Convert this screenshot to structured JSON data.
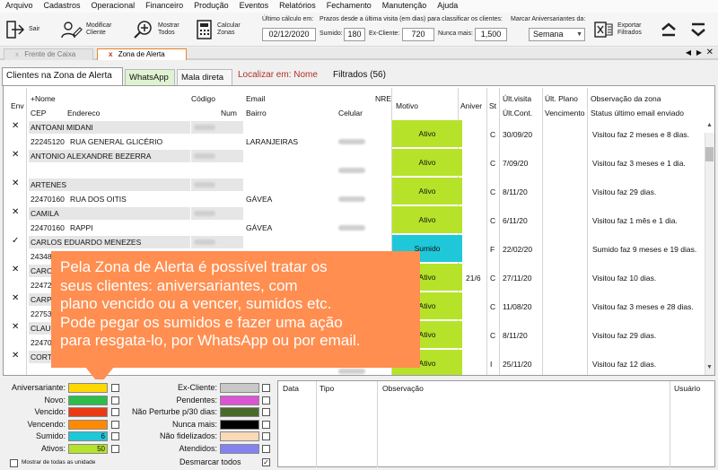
{
  "menu": [
    "Arquivo",
    "Cadastros",
    "Operacional",
    "Financeiro",
    "Produção",
    "Eventos",
    "Relatórios",
    "Fechamento",
    "Manutenção",
    "Ajuda"
  ],
  "toolbar": {
    "sair": "Sair",
    "modificar": [
      "Modificar",
      "Cliente"
    ],
    "mostrar": [
      "Mostrar",
      "Todos"
    ],
    "calcular": [
      "Calcular",
      "Zonas"
    ],
    "ultimo_calculo_label": "Último cálculo em:",
    "ultimo_calculo_value": "02/12/2020",
    "prazos_label": "Prazos desde a última visita (em dias) para classificar os clientes:",
    "sumido_label": "Sumido:",
    "sumido_value": "180",
    "excliente_label": "Ex-Cliente:",
    "excliente_value": "720",
    "nunca_label": "Nunca mais:",
    "nunca_value": "1,500",
    "aniv_label": "Marcar Aniversariantes da:",
    "aniv_value": "Semana",
    "exportar": [
      "Exportar",
      "Filtrados"
    ]
  },
  "doc_tabs": {
    "caixa": "Frente de Caixa",
    "alerta": "Zona de Alerta",
    "close": "x"
  },
  "sub_tabs": {
    "zona": "Clientes na Zona de Alerta",
    "whats": "WhatsApp",
    "mala": "Mala direta",
    "localizar": "Localizar em: Nome",
    "filtrados": "Filtrados (56)"
  },
  "grid_headers": {
    "env": "Env",
    "nome": "+Nome",
    "codigo": "Código",
    "email": "Email",
    "nre": "NRE",
    "motivo": "Motivo",
    "aniver": "Aniver",
    "st": "St",
    "ult_visita": "Últ.visita",
    "ult_plano": "Últ. Plano",
    "obs": "Observação da zona",
    "cep": "CEP",
    "endereco": "Endereco",
    "num": "Num",
    "bairro": "Bairro",
    "celular": "Celular",
    "ult_cont": "Últ.Cont.",
    "vencimento": "Vencimento",
    "status_email": "Status último email enviado"
  },
  "clients": [
    {
      "env": "✕",
      "nome": "ANTOANI MIDANI",
      "cep": "22245120",
      "end": "RUA GENERAL GLICÉRIO",
      "bairro": "LARANJEIRAS",
      "motivo": "Ativo",
      "aniver": "",
      "st": "C",
      "visita": "30/09/20",
      "obs": "Visitou faz 2 meses e 8 dias."
    },
    {
      "env": "✕",
      "nome": "ANTONIO ALEXANDRE BEZERRA",
      "cep": "",
      "end": "",
      "bairro": "",
      "motivo": "Ativo",
      "aniver": "",
      "st": "C",
      "visita": "7/09/20",
      "obs": "Visitou faz 3 meses e 1 dia."
    },
    {
      "env": "✕",
      "nome": "ARTENES",
      "cep": "22470160",
      "end": "RUA DOS OITIS",
      "bairro": "GÁVEA",
      "motivo": "Ativo",
      "aniver": "",
      "st": "C",
      "visita": "8/11/20",
      "obs": "Visitou faz 29 dias."
    },
    {
      "env": "✕",
      "nome": "CAMILA",
      "cep": "22470160",
      "end": "RAPPI",
      "bairro": "GÁVEA",
      "motivo": "Ativo",
      "aniver": "",
      "st": "C",
      "visita": "6/11/20",
      "obs": "Visitou faz 1 mês e 1 dia."
    },
    {
      "env": "✓",
      "nome": "CARLOS EDUARDO MENEZES",
      "cep": "24348",
      "end": "",
      "bairro": "",
      "motivo": "Sumido",
      "aniver": "",
      "st": "F",
      "visita": "22/02/20",
      "obs": "Sumido faz 9 meses e 19 dias."
    },
    {
      "env": "✕",
      "nome": "CAROL",
      "cep": "22472",
      "end": "",
      "bairro": "",
      "motivo": "Ativo",
      "aniver": "21/6",
      "st": "C",
      "visita": "27/11/20",
      "obs": "Visitou faz 10 dias."
    },
    {
      "env": "✕",
      "nome": "CARPE",
      "cep": "22753",
      "end": "",
      "bairro": "",
      "motivo": "Ativo",
      "aniver": "",
      "st": "C",
      "visita": "11/08/20",
      "obs": "Visitou faz 3 meses e 28 dias."
    },
    {
      "env": "✕",
      "nome": "CLAUD",
      "cep": "22470",
      "end": "",
      "bairro": "",
      "motivo": "Ativo",
      "aniver": "",
      "st": "C",
      "visita": "8/11/20",
      "obs": "Visitou faz 29 dias."
    },
    {
      "env": "✕",
      "nome": "CORTE",
      "cep": "",
      "end": "",
      "bairro": "",
      "motivo": "Ativo",
      "aniver": "",
      "st": "I",
      "visita": "25/11/20",
      "obs": "Visitou faz 12 dias."
    }
  ],
  "callout": [
    "Pela Zona de Alerta é possível tratar os",
    "seus clientes: aniversariantes, com",
    "plano vencido ou a vencer, sumidos etc.",
    "Pode pegar os sumidos e fazer uma ação",
    "para resgata-lo, por WhatsApp ou por email."
  ],
  "legend_left": [
    {
      "label": "Aniversariante:",
      "color": "#ffd800",
      "count": ""
    },
    {
      "label": "Novo:",
      "color": "#2ebd4b",
      "count": ""
    },
    {
      "label": "Vencido:",
      "color": "#ea3a14",
      "count": ""
    },
    {
      "label": "Vencendo:",
      "color": "#ff8a00",
      "count": ""
    },
    {
      "label": "Sumido:",
      "color": "#1ec8d8",
      "count": "6"
    },
    {
      "label": "Ativos:",
      "color": "#b6e32a",
      "count": "50"
    }
  ],
  "legend_right": [
    {
      "label": "Ex-Cliente:",
      "color": "#c8c8c8"
    },
    {
      "label": "Pendentes:",
      "color": "#d955d4"
    },
    {
      "label": "Não Perturbe p/30 dias:",
      "color": "#4a6a2a"
    },
    {
      "label": "Nunca mais:",
      "color": "#000000"
    },
    {
      "label": "Não fidelizados:",
      "color": "#f8d9b8"
    },
    {
      "label": "Atendidos:",
      "color": "#8383f0"
    }
  ],
  "mostrar_unidades": "Mostrar de todas as unidade",
  "desmarcar_todos": "Desmarcar todos",
  "detail_headers": {
    "data": "Data",
    "tipo": "Tipo",
    "obs": "Observação",
    "usuario": "Usuário"
  },
  "colors": {
    "ativo": "#b6e32a",
    "sumido": "#1ec8d8",
    "callout": "#ff8e50",
    "tab_accent": "#e8852d"
  }
}
